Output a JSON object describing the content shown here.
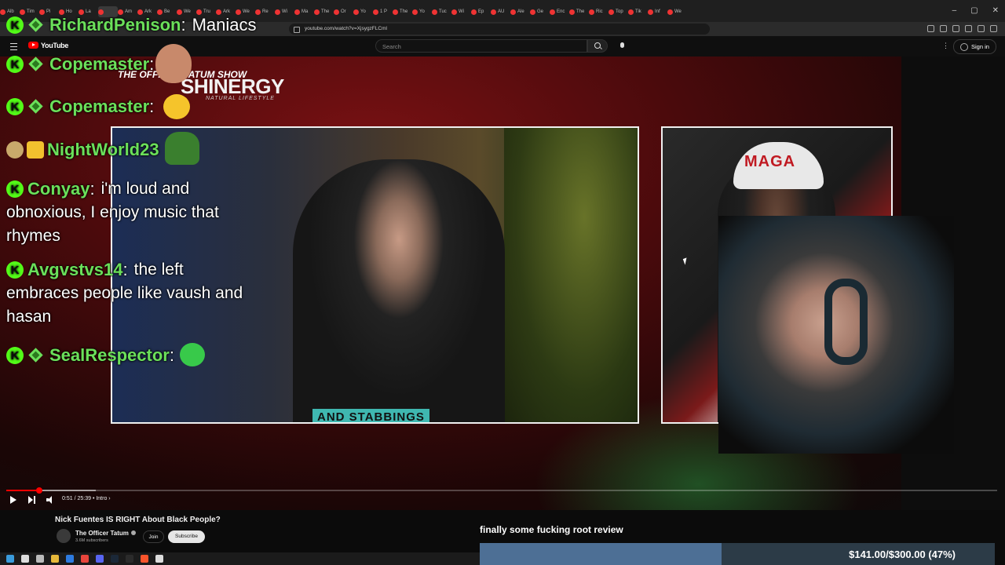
{
  "browser": {
    "tabs": [
      "Alb",
      "Tim",
      "Pi",
      "Ho",
      "La",
      "",
      "Am",
      "Ark",
      "Be",
      "We",
      "Tru",
      "Ark",
      "We",
      "Re",
      "Wi",
      "Ma",
      "The",
      "Or",
      "Yo",
      "1 P",
      "The",
      "Yo",
      "Tuc",
      "Wi",
      "Ep",
      "AU",
      "Ale",
      "Ge",
      "Enc",
      "The",
      "Ric",
      "Top",
      "Tik",
      "Inf",
      "We"
    ],
    "url": "youtube.com/watch?v=XjsygzFLCml",
    "window_controls": [
      "–",
      "▢",
      "✕"
    ]
  },
  "youtube": {
    "logo_text": "YouTube",
    "search_placeholder": "Search",
    "sign_in": "Sign in",
    "more": "⋮"
  },
  "video": {
    "caption": "AND STABBINGS",
    "brand_left": "THE OFFICER TATUM SHOW",
    "brand_right": "SHINERGY",
    "brand_sub": "NATURAL LIFESTYLE",
    "hat_text": "MAGA"
  },
  "chat": {
    "m1": {
      "user": "RichardPenison",
      "text": "Maniacs"
    },
    "m2": {
      "user": "Copemaster",
      "text": ""
    },
    "m3": {
      "user": "Copemaster",
      "text": ""
    },
    "m4": {
      "user": "NightWorld23",
      "text": ""
    },
    "m5": {
      "user": "Conyay",
      "text": "i'm loud and",
      "line2": "obnoxious, I enjoy music that",
      "line3": "rhymes"
    },
    "m6": {
      "user": "Avgvstvs14",
      "text": "the left",
      "line2": "embraces people like vaush and",
      "line3": "hasan"
    },
    "m7": {
      "user": "SealRespector",
      "text": ""
    },
    "colon": ":",
    "badge_letter": "K"
  },
  "player": {
    "time": "0:51 / 25:39",
    "chapter": "• Intro ›",
    "progress_fraction": 0.033
  },
  "below": {
    "title": "Nick Fuentes IS RIGHT About Black People?",
    "channel": "The Officer Tatum",
    "subscribers": "3.6M subscribers",
    "join": "Join",
    "subscribe": "Subscribe"
  },
  "stream_overlay": {
    "donation_message": "finally some fucking root review",
    "goal_label": "$141.00/$300.00 (47%)",
    "goal_fraction": 0.47
  },
  "colors": {
    "kick_green": "#53fc18",
    "username_green": "#6be05a",
    "goal_fill": "#4d6f95",
    "goal_bg": "#2c3b47"
  },
  "taskbar_icons": [
    "windows-icon",
    "search-icon",
    "taskview-icon",
    "explorer-icon",
    "edge-icon",
    "chrome-icon",
    "discord-icon",
    "steam-icon",
    "terminal-icon",
    "brave-icon",
    "obs-icon"
  ]
}
